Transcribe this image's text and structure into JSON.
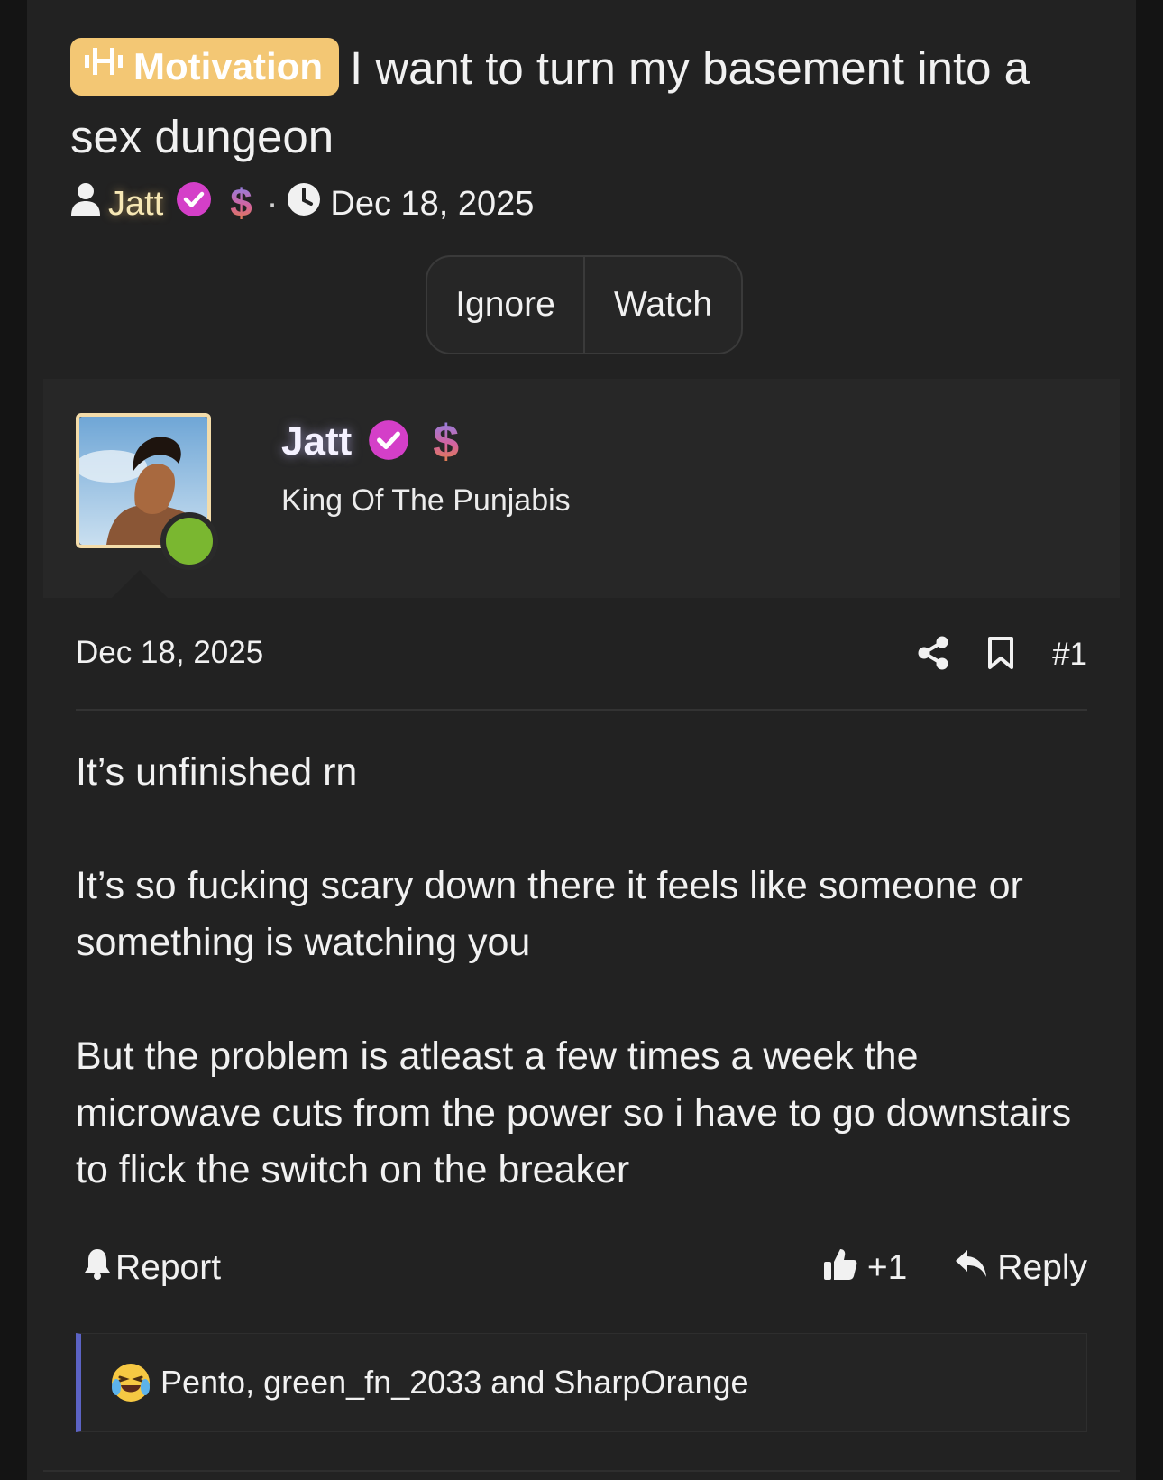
{
  "thread": {
    "prefix_label": "Motivation",
    "title": "I want to turn my basement into a sex dungeon",
    "author": "Jatt",
    "date": "Dec 18, 2025",
    "dollar_symbol": "$",
    "separator": "·"
  },
  "thread_buttons": {
    "ignore": "Ignore",
    "watch": "Watch"
  },
  "post": {
    "username": "Jatt",
    "user_title": "King Of The Punjabis",
    "dollar_symbol": "$",
    "date": "Dec 18, 2025",
    "number": "#1",
    "paragraphs": [
      "It’s unfinished rn",
      "It’s so fucking scary down there it feels like someone or something is watching you",
      "But the problem is atleast a few times a week the microwave cuts from the power so i have to go downstairs to flick the switch on the breaker"
    ],
    "report_label": "Report",
    "like_count": "+1",
    "reply_label": "Reply",
    "reactions_text": "Pento, green_fn_2033 and SharpOrange"
  },
  "colors": {
    "prefix_bg": "#f3c774",
    "verified": "#d43fc8",
    "online": "#7ab730",
    "reactions_bar": "#5c63c4"
  },
  "icons": [
    "bars-icon",
    "user-icon",
    "verified-icon",
    "clock-icon",
    "share-icon",
    "bookmark-icon",
    "bell-icon",
    "thumbs-up-icon",
    "reply-icon",
    "laughing-crying-emoji"
  ]
}
